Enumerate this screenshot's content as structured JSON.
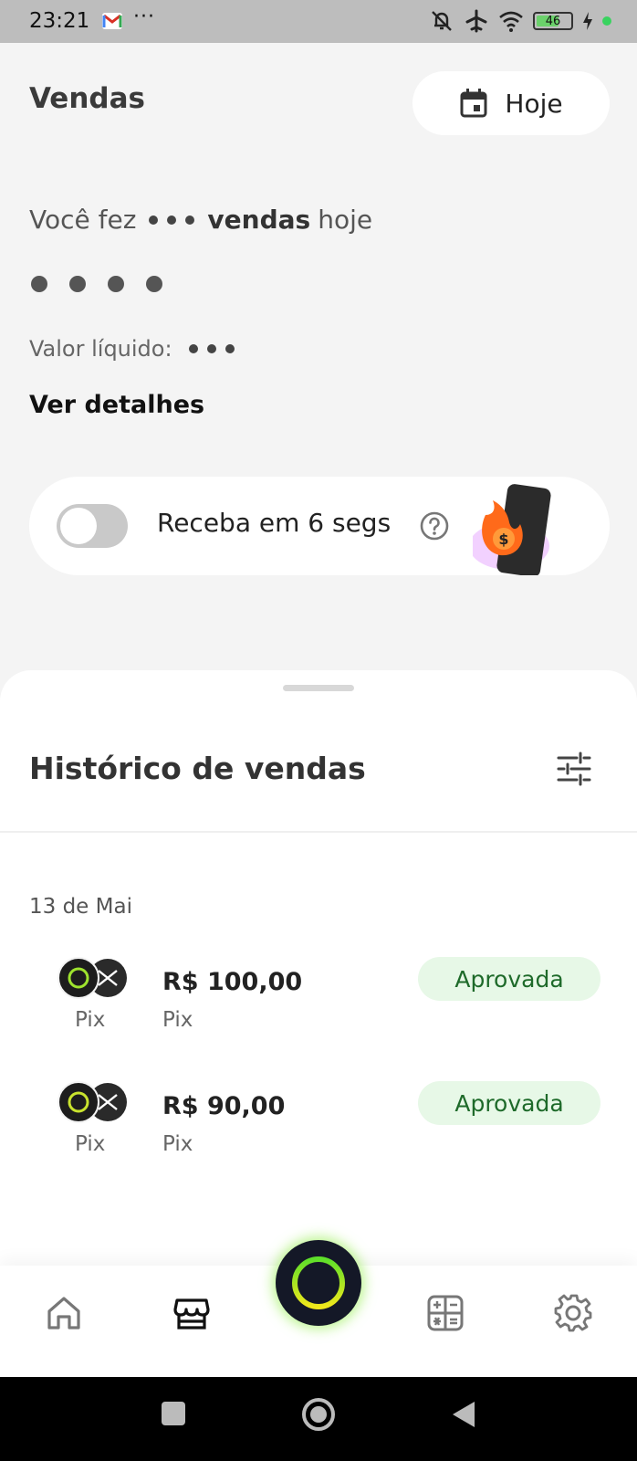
{
  "status_bar": {
    "time": "23:21",
    "battery": "46",
    "icons": [
      "gmail-icon",
      "more-dots",
      "mute-icon",
      "airplane-icon",
      "wifi-icon",
      "battery-icon",
      "charging-icon",
      "green-dot"
    ]
  },
  "header": {
    "title": "Vendas",
    "date_filter_label": "Hoje",
    "date_filter_icon": "calendar-icon"
  },
  "summary": {
    "sales_prefix": "Você fez",
    "sales_bold": "vendas",
    "sales_suffix": "hoje",
    "net_label": "Valor líquido:",
    "details_link": "Ver detalhes"
  },
  "instant_receive": {
    "label": "Receba em 6 segs",
    "toggle_on": false
  },
  "history": {
    "title": "Histórico de vendas",
    "filter_icon": "sliders-icon",
    "groups": [
      {
        "date": "13 de Mai",
        "sales": [
          {
            "method": "Pix",
            "amount": "R$ 100,00",
            "subtitle": "Pix",
            "status": "Aprovada"
          },
          {
            "method": "Pix",
            "amount": "R$ 90,00",
            "subtitle": "Pix",
            "status": "Aprovada"
          }
        ]
      }
    ]
  },
  "bottom_nav": {
    "items": [
      "home-icon",
      "store-icon",
      "center-action",
      "calculator-icon",
      "settings-icon"
    ],
    "active": "store-icon"
  },
  "colors": {
    "accent_green": "#7eeb28",
    "badge_bg": "#e7f8e7",
    "badge_text": "#1e6a2a",
    "center_btn": "#141827"
  }
}
